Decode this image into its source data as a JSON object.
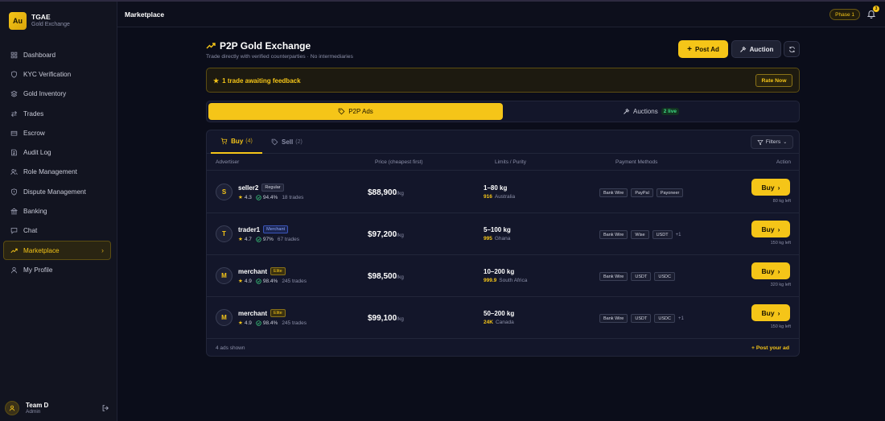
{
  "brand": {
    "logo": "Au",
    "name": "TGAE",
    "subtitle": "Gold Exchange"
  },
  "nav": [
    {
      "label": "Dashboard",
      "icon": "grid-icon"
    },
    {
      "label": "KYC Verification",
      "icon": "shield-icon"
    },
    {
      "label": "Gold Inventory",
      "icon": "layers-icon"
    },
    {
      "label": "Trades",
      "icon": "swap-icon"
    },
    {
      "label": "Escrow",
      "icon": "escrow-icon"
    },
    {
      "label": "Audit Log",
      "icon": "log-icon"
    },
    {
      "label": "Role Management",
      "icon": "users-icon"
    },
    {
      "label": "Dispute Management",
      "icon": "dispute-icon"
    },
    {
      "label": "Banking",
      "icon": "bank-icon"
    },
    {
      "label": "Chat",
      "icon": "chat-icon"
    },
    {
      "label": "Marketplace",
      "icon": "trend-icon",
      "active": true
    },
    {
      "label": "My Profile",
      "icon": "user-icon"
    }
  ],
  "user": {
    "name": "Team D",
    "role": "Admin"
  },
  "topbar": {
    "title": "Marketplace",
    "phase": "Phase 1",
    "notifications": "3"
  },
  "header": {
    "title": "P2P Gold Exchange",
    "subtitle": "Trade directly with verified counterparties · No intermediaries",
    "post_ad": "Post Ad",
    "auction": "Auction"
  },
  "alert": {
    "text": "1 trade awaiting feedback",
    "action": "Rate Now"
  },
  "switcher": {
    "p2p": "P2P Ads",
    "auctions": "Auctions",
    "live": "2 live"
  },
  "tabs": {
    "buy": "Buy",
    "buy_count": "(4)",
    "sell": "Sell",
    "sell_count": "(2)",
    "filters": "Filters"
  },
  "columns": [
    "Advertiser",
    "Price (cheapest first)",
    "Limits / Purity",
    "Payment Methods",
    "Action"
  ],
  "rows": [
    {
      "initial": "S",
      "name": "seller2",
      "tier": "Regular",
      "tier_class": "regular",
      "rating": "4.3",
      "completion": "94.4%",
      "trades": "18 trades",
      "price": "$88,900",
      "unit": "/kg",
      "limits": "1–80 kg",
      "purity": "916",
      "country": "Australia",
      "payments": [
        "Bank Wire",
        "PayPal",
        "Payoneer"
      ],
      "more": "",
      "action": "Buy",
      "left": "80 kg left"
    },
    {
      "initial": "T",
      "name": "trader1",
      "tier": "Merchant",
      "tier_class": "merchant",
      "rating": "4.7",
      "completion": "97%",
      "trades": "67 trades",
      "price": "$97,200",
      "unit": "/kg",
      "limits": "5–100 kg",
      "purity": "995",
      "country": "Ghana",
      "payments": [
        "Bank Wire",
        "Wise",
        "USDT"
      ],
      "more": "+1",
      "action": "Buy",
      "left": "150 kg left"
    },
    {
      "initial": "M",
      "name": "merchant",
      "tier": "Elite",
      "tier_class": "elite",
      "rating": "4.9",
      "completion": "98.4%",
      "trades": "245 trades",
      "price": "$98,500",
      "unit": "/kg",
      "limits": "10–200 kg",
      "purity": "999.9",
      "country": "South Africa",
      "payments": [
        "Bank Wire",
        "USDT",
        "USDC"
      ],
      "more": "",
      "action": "Buy",
      "left": "320 kg left"
    },
    {
      "initial": "M",
      "name": "merchant",
      "tier": "Elite",
      "tier_class": "elite",
      "rating": "4.9",
      "completion": "98.4%",
      "trades": "245 trades",
      "price": "$99,100",
      "unit": "/kg",
      "limits": "50–200 kg",
      "purity": "24K",
      "country": "Canada",
      "payments": [
        "Bank Wire",
        "USDT",
        "USDC"
      ],
      "more": "+1",
      "action": "Buy",
      "left": "150 kg left"
    }
  ],
  "footer": {
    "count": "4 ads shown",
    "post": "+ Post your ad"
  },
  "colors": {
    "accent": "#f5c518",
    "background": "#0b0d1a",
    "panel": "#13162a",
    "success": "#3ddc84"
  }
}
